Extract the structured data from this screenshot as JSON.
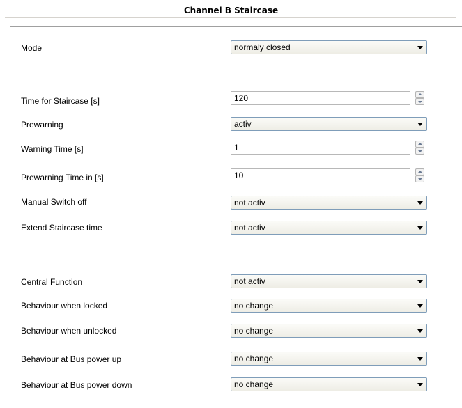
{
  "title": "Channel  B Staircase",
  "params": {
    "mode": {
      "label": "Mode",
      "value": "normaly closed"
    },
    "time_staircase": {
      "label": "Time for Staircase [s]",
      "value": "120"
    },
    "prewarning": {
      "label": "Prewarning",
      "value": "activ"
    },
    "warning_time": {
      "label": "Warning Time [s]",
      "value": "1"
    },
    "prewarning_time": {
      "label": "Prewarning Time in [s]",
      "value": "10"
    },
    "manual_switch_off": {
      "label": "Manual Switch off",
      "value": "not activ"
    },
    "extend_staircase": {
      "label": "Extend Staircase time",
      "value": "not activ"
    },
    "central_function": {
      "label": "Central Function",
      "value": "not activ"
    },
    "behaviour_locked": {
      "label": "Behaviour when locked",
      "value": "no change"
    },
    "behaviour_unlocked": {
      "label": "Behaviour when unlocked",
      "value": "no change"
    },
    "behaviour_power_up": {
      "label": "Behaviour at Bus power up",
      "value": "no change"
    },
    "behaviour_power_down": {
      "label": "Behaviour at Bus power down",
      "value": "no change"
    }
  },
  "icons": {
    "dropdown": "chevron-down-icon",
    "spin_up": "spin-up-icon",
    "spin_down": "spin-down-icon"
  }
}
